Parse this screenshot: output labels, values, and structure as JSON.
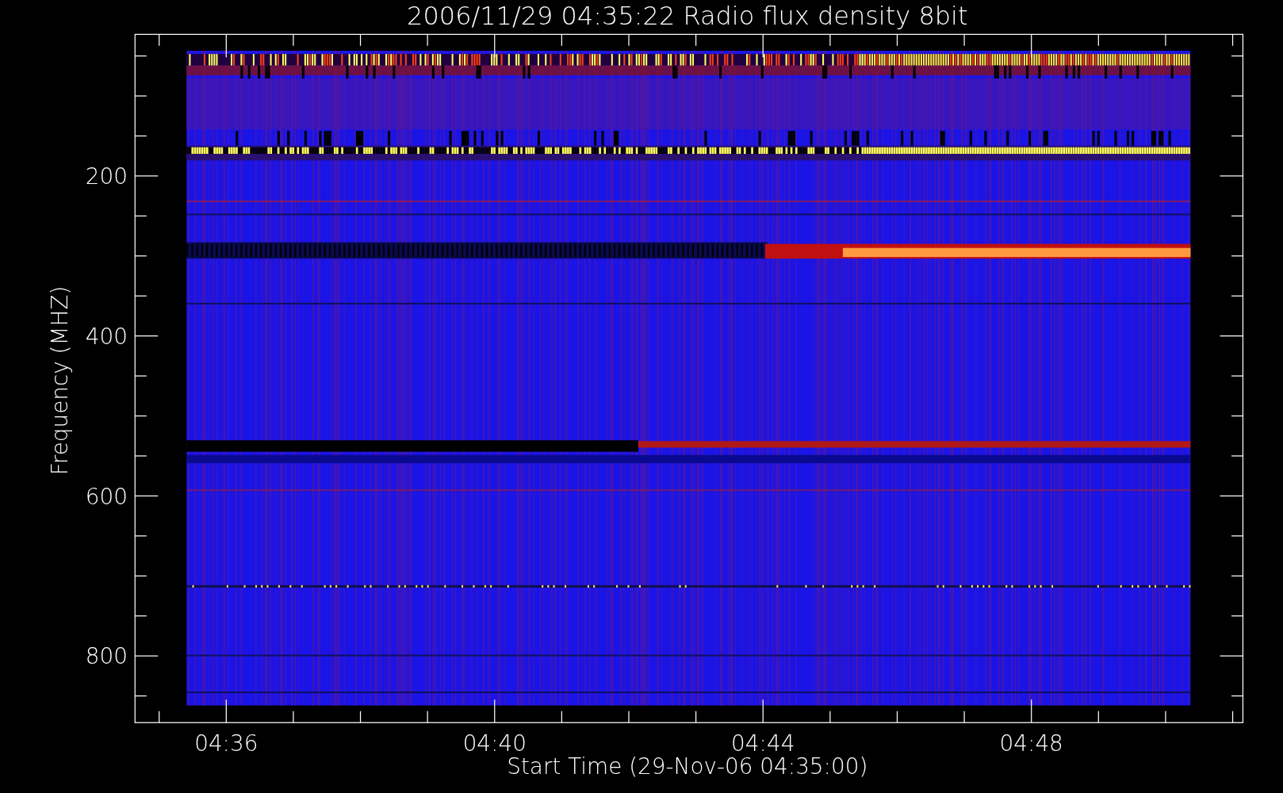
{
  "plot": {
    "title": "2006/11/29 04:35:22 Radio flux density 8bit",
    "xlabel": "Start Time (29-Nov-06 04:35:00)",
    "ylabel": "Frequency (MHZ)",
    "xtick_labels": [
      "04:36",
      "04:40",
      "04:44",
      "04:48"
    ],
    "ytick_labels": [
      "200",
      "400",
      "600",
      "800"
    ]
  }
}
